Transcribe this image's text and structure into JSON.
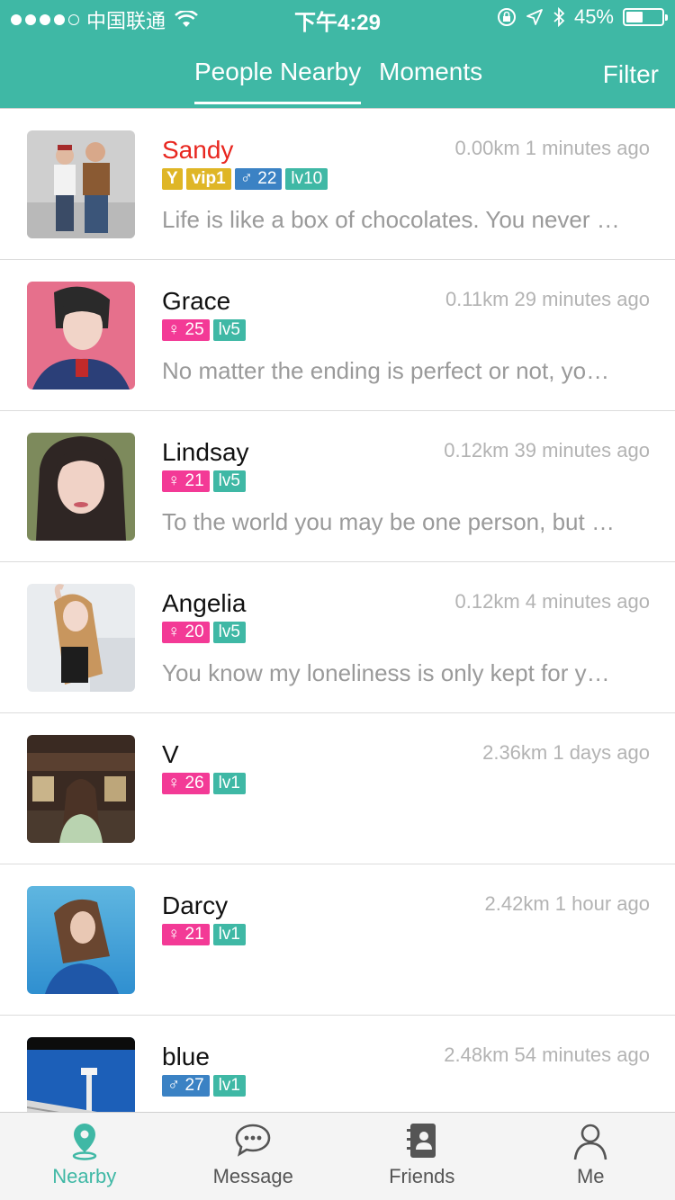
{
  "status": {
    "carrier": "中国联通",
    "time": "下午4:29",
    "battery": "45%",
    "battery_level_percent": 45
  },
  "nav": {
    "tab_nearby": "People Nearby",
    "tab_moments": "Moments",
    "filter": "Filter",
    "active_tab": "People Nearby"
  },
  "people": [
    {
      "name": "Sandy",
      "distance_time": "0.00km 1 minutes ago",
      "y": "Y",
      "vip": "vip1",
      "gender": "♂ 22",
      "level": "lv10",
      "bio": "Life is like a box of chocolates. You never know what you're gonna get."
    },
    {
      "name": "Grace",
      "distance_time": "0.11km 29 minutes ago",
      "gender": "♀ 25",
      "level": "lv5",
      "bio": "No matter the ending is perfect or not, you cannot disappear from my life."
    },
    {
      "name": "Lindsay",
      "distance_time": "0.12km 39 minutes ago",
      "gender": "♀ 21",
      "level": "lv5",
      "bio": "To the world you may be one person, but to one person you may be the world."
    },
    {
      "name": "Angelia",
      "distance_time": "0.12km 4 minutes ago",
      "gender": "♀ 20",
      "level": "lv5",
      "bio": "You know my loneliness is only kept for you, my sweet songs only sing for you."
    },
    {
      "name": "V",
      "distance_time": "2.36km 1 days ago",
      "gender": "♀ 26",
      "level": "lv1",
      "bio": ""
    },
    {
      "name": "Darcy",
      "distance_time": "2.42km 1 hour ago",
      "gender": "♀ 21",
      "level": "lv1",
      "bio": ""
    },
    {
      "name": "blue",
      "distance_time": "2.48km 54 minutes ago",
      "gender": "♂ 27",
      "level": "lv1",
      "bio": ""
    }
  ],
  "tabbar": {
    "nearby": "Nearby",
    "message": "Message",
    "friends": "Friends",
    "me": "Me"
  },
  "colors": {
    "accent": "#3fb8a5",
    "vip_name": "#e8261f",
    "vip_badge": "#dfb626",
    "male_badge": "#3b82c4",
    "female_badge": "#f33a96"
  }
}
